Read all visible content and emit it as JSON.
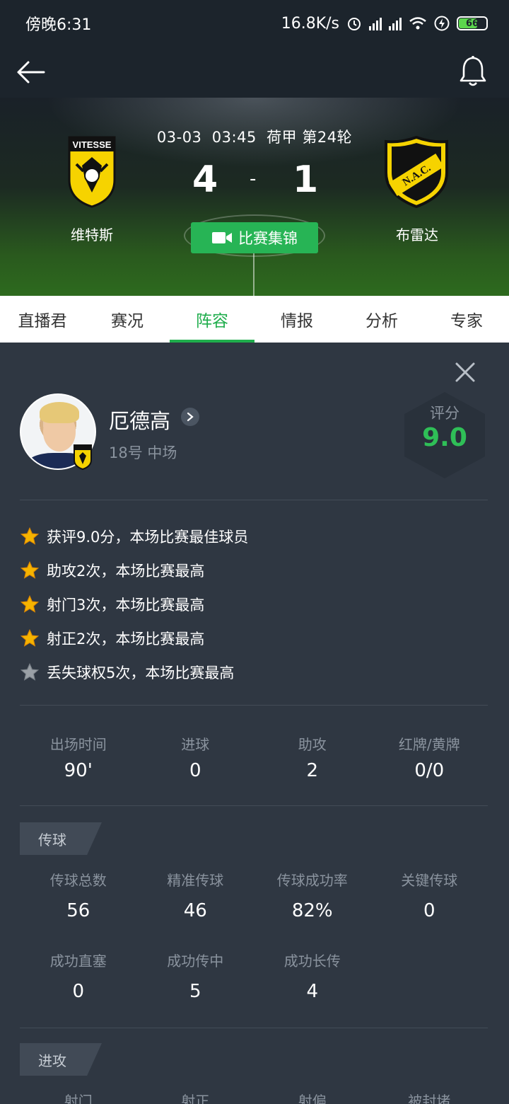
{
  "status_bar": {
    "time": "傍晚6:31",
    "speed": "16.8K/s",
    "battery": "66"
  },
  "match": {
    "date": "03-03",
    "time": "03:45",
    "league": "荷甲",
    "round": "第24轮",
    "home_score": "4",
    "separator": "-",
    "away_score": "1",
    "home_team": "维特斯",
    "away_team": "布雷达",
    "home_logo_text": "VITESSE",
    "away_logo_text": "N.A.C.",
    "highlights_label": "比赛集锦"
  },
  "tabs": [
    {
      "label": "直播君"
    },
    {
      "label": "赛况"
    },
    {
      "label": "阵容",
      "active": true
    },
    {
      "label": "情报"
    },
    {
      "label": "分析"
    },
    {
      "label": "专家"
    }
  ],
  "player": {
    "name": "厄德高",
    "info": "18号 中场",
    "rating_label": "评分",
    "rating_value": "9.0"
  },
  "achievements": [
    {
      "text": "获评9.0分，本场比赛最佳球员",
      "star": "gold"
    },
    {
      "text": "助攻2次，本场比赛最高",
      "star": "gold"
    },
    {
      "text": "射门3次，本场比赛最高",
      "star": "gold"
    },
    {
      "text": "射正2次，本场比赛最高",
      "star": "gold"
    },
    {
      "text": "丢失球权5次，本场比赛最高",
      "star": "gray"
    }
  ],
  "summary_stats": [
    {
      "label": "出场时间",
      "value": "90'"
    },
    {
      "label": "进球",
      "value": "0"
    },
    {
      "label": "助攻",
      "value": "2"
    },
    {
      "label": "红牌/黄牌",
      "value": "0/0"
    }
  ],
  "passing": {
    "title": "传球",
    "row1": [
      {
        "label": "传球总数",
        "value": "56"
      },
      {
        "label": "精准传球",
        "value": "46"
      },
      {
        "label": "传球成功率",
        "value": "82%"
      },
      {
        "label": "关键传球",
        "value": "0"
      }
    ],
    "row2": [
      {
        "label": "成功直塞",
        "value": "0"
      },
      {
        "label": "成功传中",
        "value": "5"
      },
      {
        "label": "成功长传",
        "value": "4"
      }
    ]
  },
  "attack": {
    "title": "进攻",
    "row1": [
      {
        "label": "射门"
      },
      {
        "label": "射正"
      },
      {
        "label": "射偏"
      },
      {
        "label": "被封堵"
      }
    ]
  },
  "colors": {
    "accent": "#1fad4c",
    "rating": "#2fbf57",
    "card_bg": "#2f3742",
    "star_gold": "#f5b400",
    "star_gray": "#9aa0a6"
  }
}
